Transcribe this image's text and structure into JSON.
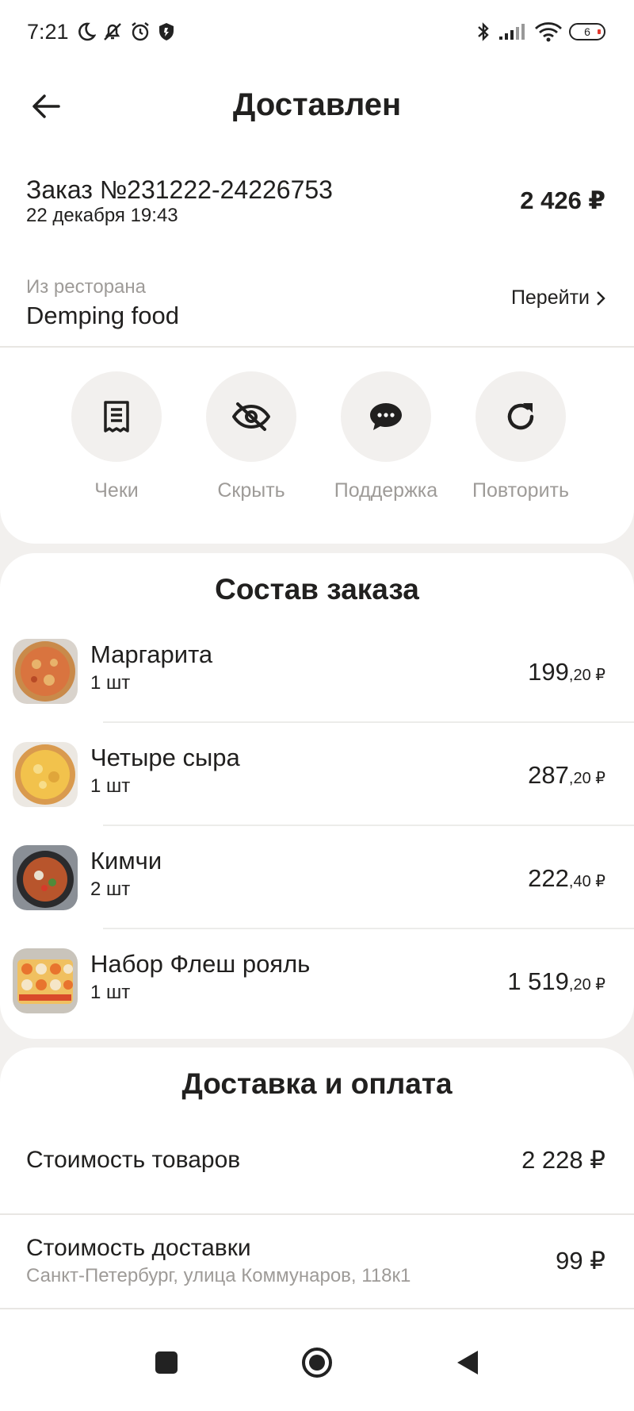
{
  "status_bar": {
    "time": "7:21",
    "battery_level": "6",
    "icons": [
      "moon-icon",
      "bell-off-icon",
      "alarm-icon",
      "shield-icon",
      "bluetooth-icon",
      "signal-icon",
      "wifi-icon",
      "battery-icon"
    ]
  },
  "header": {
    "title": "Доставлен",
    "back_icon": "back-arrow-icon"
  },
  "order": {
    "number": "Заказ №231222-24226753",
    "date": "22 декабря 19:43",
    "total": "2 426 ₽"
  },
  "restaurant": {
    "label": "Из ресторана",
    "name": "Demping food",
    "link": "Перейти"
  },
  "actions": [
    {
      "label": "Чеки",
      "icon": "receipt-icon"
    },
    {
      "label": "Скрыть",
      "icon": "eye-off-icon"
    },
    {
      "label": "Поддержка",
      "icon": "chat-icon"
    },
    {
      "label": "Повторить",
      "icon": "repeat-icon"
    }
  ],
  "order_items": {
    "title": "Состав заказа",
    "items": [
      {
        "name": "Маргарита",
        "qty": "1 шт",
        "price_main": "199",
        "price_kop": ",20 ₽",
        "image": "pizza-margherita"
      },
      {
        "name": "Четыре сыра",
        "qty": "1 шт",
        "price_main": "287",
        "price_kop": ",20 ₽",
        "image": "pizza-four-cheese"
      },
      {
        "name": "Кимчи",
        "qty": "2 шт",
        "price_main": "222",
        "price_kop": ",40 ₽",
        "image": "kimchi-soup"
      },
      {
        "name": "Набор Флеш рояль",
        "qty": "1 шт",
        "price_main": "1 519",
        "price_kop": ",20 ₽",
        "image": "sushi-set"
      }
    ]
  },
  "delivery": {
    "title": "Доставка и оплата",
    "goods_label": "Стоимость товаров",
    "goods_value": "2 228 ₽",
    "delivery_label": "Стоимость доставки",
    "delivery_address": "Санкт-Петербург, улица Коммунаров, 118к1",
    "delivery_value": "99 ₽"
  },
  "navbar": {
    "icons": [
      "recents-square-icon",
      "home-circle-icon",
      "back-triangle-icon"
    ]
  }
}
